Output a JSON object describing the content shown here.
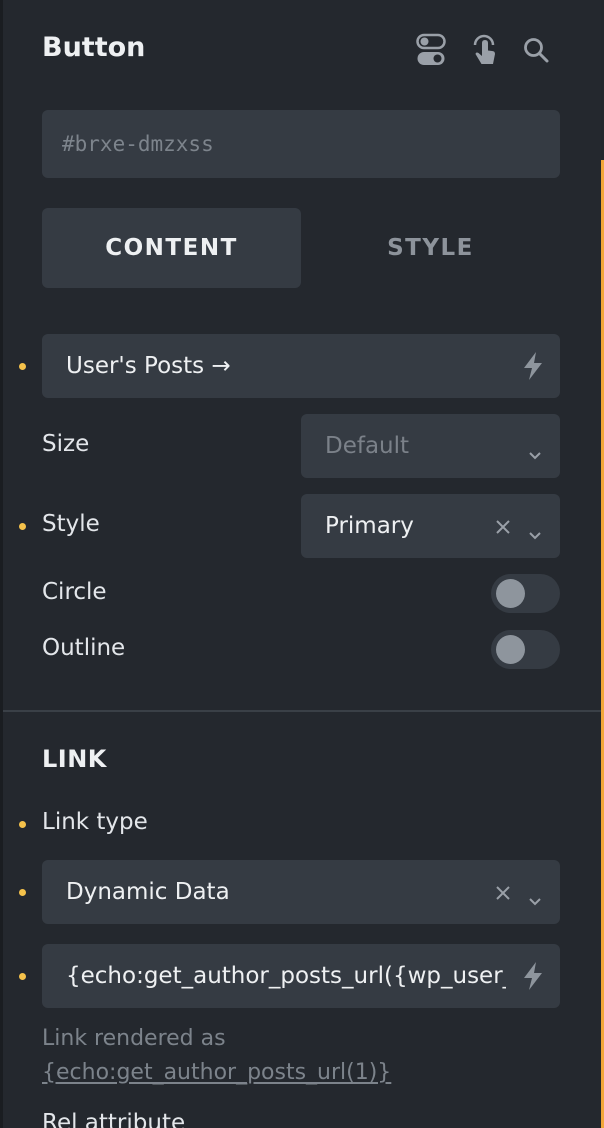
{
  "panel": {
    "title": "Button",
    "header_icons": [
      "toggle-settings-icon",
      "touch-gesture-icon",
      "search-icon"
    ]
  },
  "id_field": {
    "value": "#brxe-dmzxss"
  },
  "tabs": [
    {
      "label": "CONTENT",
      "active": true
    },
    {
      "label": "STYLE",
      "active": false
    }
  ],
  "text_field": {
    "value": "User's Posts →",
    "icon": "lightning-bolt-icon"
  },
  "size": {
    "label": "Size",
    "value": "Default"
  },
  "style": {
    "label": "Style",
    "value": "Primary"
  },
  "circle": {
    "label": "Circle",
    "on": false
  },
  "outline": {
    "label": "Outline",
    "on": false
  },
  "link_section": {
    "title": "LINK",
    "link_type_label": "Link type",
    "link_type_value": "Dynamic Data",
    "dynamic_value": "{echo:get_author_posts_url({wp_user_i",
    "hint_prefix": "Link rendered as",
    "hint_value": "{echo:get_author_posts_url(1)}",
    "next_label": "Rel attribute"
  },
  "colors": {
    "background": "#24282e",
    "field": "#353b43",
    "modified_dot": "#f5c24b",
    "accent_edge": "#f2a73a"
  }
}
